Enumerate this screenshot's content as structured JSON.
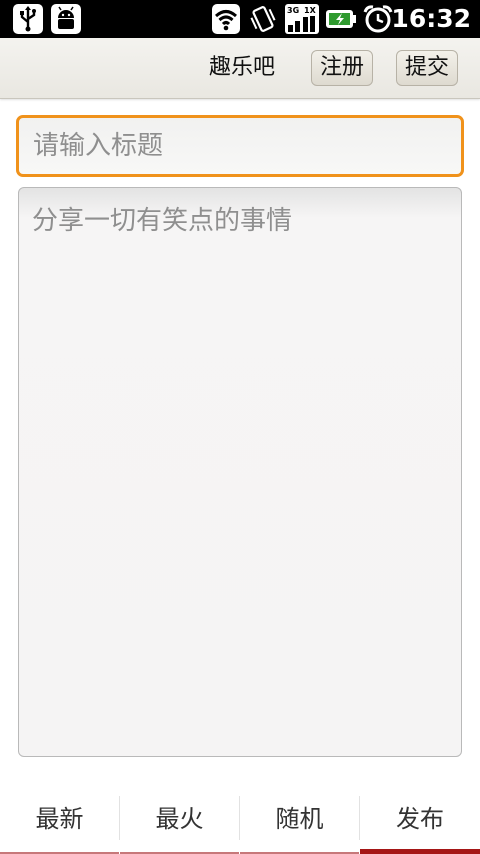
{
  "status_bar": {
    "time": "16:32",
    "icons": [
      "usb-icon",
      "android-debug-icon",
      "wifi-icon",
      "vibrate-icon",
      "signal-3g-1x-icon",
      "battery-charging-icon",
      "alarm-clock-icon"
    ]
  },
  "title_bar": {
    "title": "趣乐吧",
    "register_label": "注册",
    "submit_label": "提交"
  },
  "form": {
    "title_placeholder": "请输入标题",
    "title_value": "",
    "content_placeholder": "分享一切有笑点的事情",
    "content_value": ""
  },
  "tabs": [
    {
      "label": "最新",
      "active": false
    },
    {
      "label": "最火",
      "active": false
    },
    {
      "label": "随机",
      "active": false
    },
    {
      "label": "发布",
      "active": true
    }
  ],
  "colors": {
    "status_bar_bg": "#000000",
    "input_focus_border": "#f0921b",
    "tab_active_underline": "#a51616",
    "tab_underline": "#c7787a"
  }
}
